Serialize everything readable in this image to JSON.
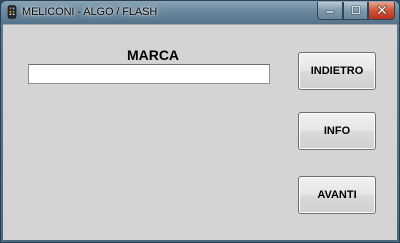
{
  "window": {
    "title": "MELICONI - ALGO / FLASH",
    "app_icon": "remote-control-icon",
    "controls": {
      "minimize_icon": "minimize-icon",
      "maximize_icon": "maximize-icon",
      "close_icon": "close-icon"
    }
  },
  "form": {
    "marca_label": "MARCA",
    "marca_value": "",
    "marca_placeholder": ""
  },
  "buttons": {
    "indietro": "INDIETRO",
    "info": "INFO",
    "avanti": "AVANTI"
  },
  "colors": {
    "client_background": "#d4d4d4",
    "close_button": "#c8442a",
    "titlebar": "#6a879c"
  }
}
